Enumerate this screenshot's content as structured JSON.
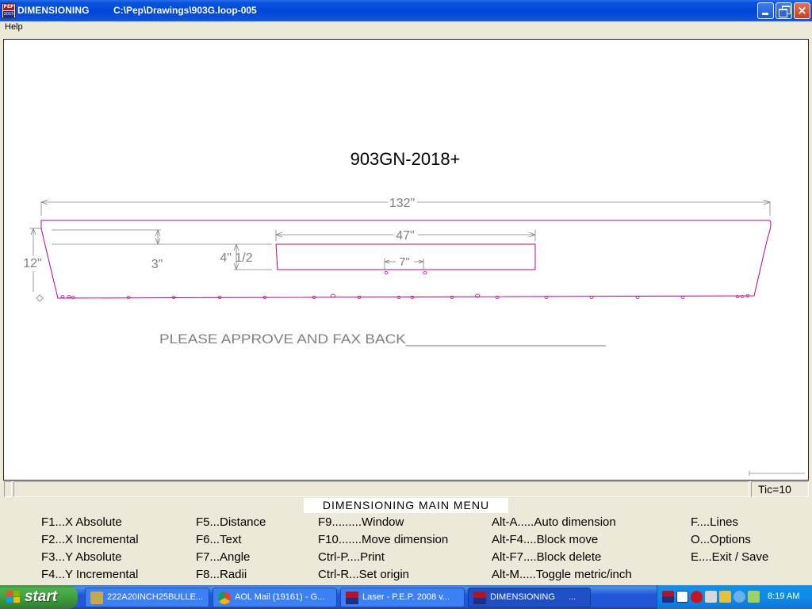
{
  "window": {
    "app_name": "DIMENSIONING",
    "file_path": "C:\\Pep\\Drawings\\903G.loop-005",
    "close_glyph": "×"
  },
  "menubar": {
    "items": [
      {
        "label": "Help"
      }
    ]
  },
  "drawing": {
    "title": "903GN-2018+",
    "dim_overall": "132\"",
    "dim_height": "12\"",
    "dim_slot_width": "47\"",
    "dim_slot_depth": "3\"",
    "dim_slot_inset": "4\" 1/2",
    "dim_tab_spacing": "7\"",
    "note": "PLEASE APPROVE AND FAX BACK________________________",
    "line_color": "#c0008c",
    "dim_color": "#808080"
  },
  "status": {
    "tic": "Tic=10"
  },
  "function_menu": {
    "title": "DIMENSIONING MAIN MENU",
    "columns": [
      [
        "F1...X Absolute",
        "F2...X Incremental",
        "F3...Y Absolute",
        "F4...Y Incremental"
      ],
      [
        "F5...Distance",
        "F6...Text",
        "F7...Angle",
        "F8...Radii"
      ],
      [
        "F9.........Window",
        "F10.......Move dimension",
        "Ctrl-P....Print",
        "Ctrl-R...Set origin"
      ],
      [
        "Alt-A.....Auto dimension",
        "Alt-F4....Block move",
        "Alt-F7....Block delete",
        "Alt-M.....Toggle metric/inch"
      ],
      [
        "F....Lines",
        "O...Options",
        "E....Exit / Save"
      ]
    ]
  },
  "taskbar": {
    "start_label": "start",
    "tasks": [
      {
        "label": "222A20INCH25BULLE...",
        "icon": "trident-icon"
      },
      {
        "label": "AOL Mail (19161) - G...",
        "icon": "chrome-icon"
      },
      {
        "label": "Laser - P.E.P. 2008 v...",
        "icon": "pep-icon"
      },
      {
        "label": "DIMENSIONING",
        "icon": "pep-icon",
        "extra": "..."
      }
    ],
    "clock": "8:19 AM"
  },
  "app_icon": {
    "top_text": "PEP",
    "bottom_text": "2015"
  }
}
